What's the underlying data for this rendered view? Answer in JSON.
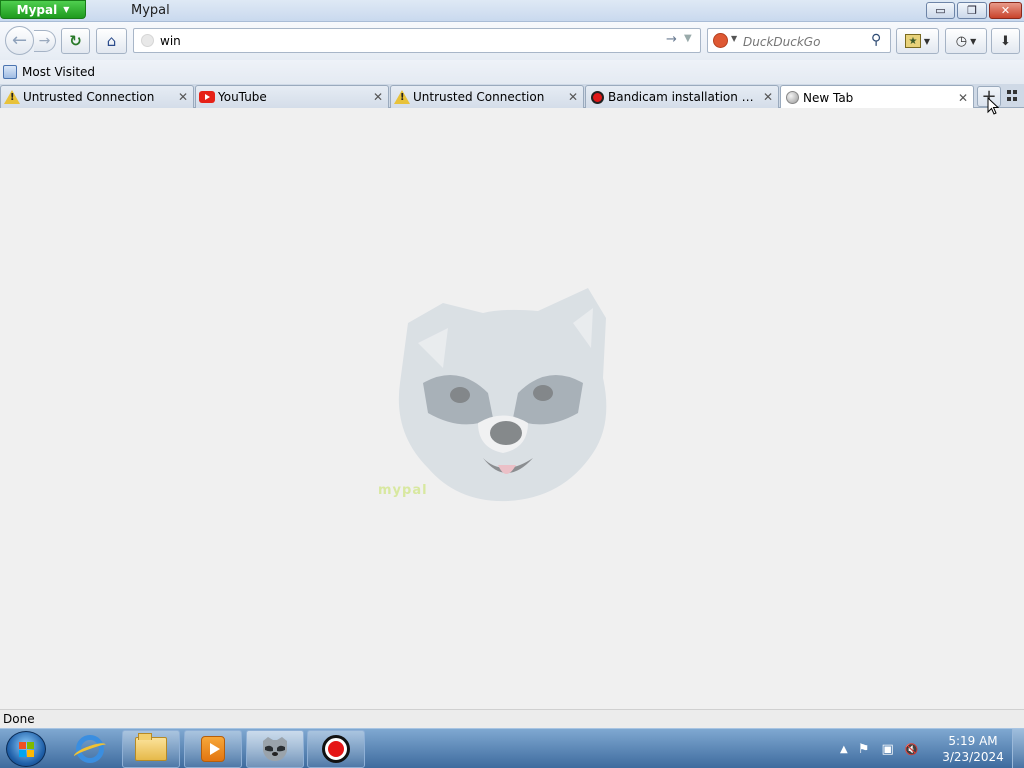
{
  "window": {
    "app_button_label": "Mypal",
    "title": "Mypal",
    "controls": {
      "minimize": "▭",
      "restore": "❐",
      "close": "✕"
    }
  },
  "navbar": {
    "back_icon": "←",
    "forward_icon": "→",
    "reload_icon": "↻",
    "home_icon": "⌂",
    "url_value": "win",
    "url_go_icon": "→",
    "url_dropdown_icon": "▼",
    "search_placeholder": "DuckDuckGo",
    "search_engine_icon": "duckduckgo-icon",
    "search_go_icon": "⚲",
    "bookmarks_icon": "★",
    "history_icon": "◷",
    "download_icon": "⬇"
  },
  "bookmarks_bar": {
    "items": [
      {
        "label": "Most Visited",
        "icon": "bookmark-folder-icon"
      }
    ]
  },
  "tabs": [
    {
      "label": "Untrusted Connection",
      "icon": "warning-icon",
      "active": false
    },
    {
      "label": "YouTube",
      "icon": "youtube-icon",
      "active": false
    },
    {
      "label": "Untrusted Connection",
      "icon": "warning-icon",
      "active": false
    },
    {
      "label": "Bandicam installation com...",
      "icon": "bandicam-icon",
      "active": false
    },
    {
      "label": "New Tab",
      "icon": "globe-icon",
      "active": true
    }
  ],
  "tab_close_icon": "✕",
  "new_tab_icon": "+",
  "content": {
    "logo_text": "mypal"
  },
  "status": {
    "text": "Done"
  },
  "taskbar": {
    "pinned": [
      "internet-explorer-icon",
      "file-explorer-icon",
      "media-player-icon",
      "mypal-raccoon-icon",
      "bandicam-icon"
    ],
    "tray": {
      "show_hidden_icon": "▲",
      "flag_icon": "⚑",
      "network_icon": "▣",
      "volume_icon": "🔇"
    },
    "clock": {
      "time": "5:19 AM",
      "date": "3/23/2024"
    }
  },
  "colors": {
    "app_button": "#1e9a1e",
    "start_orb": "#1f5fa8",
    "taskbar": "#3e6b9e"
  }
}
